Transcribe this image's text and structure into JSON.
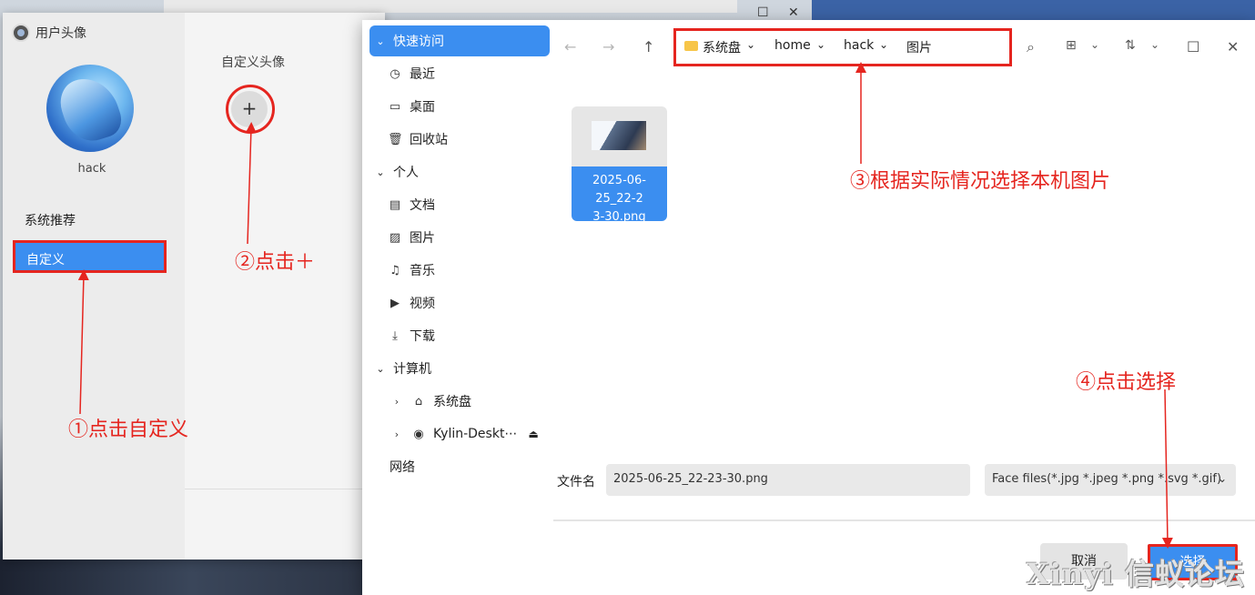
{
  "avatar_window": {
    "title": "用户头像",
    "user_name": "hack",
    "nav": {
      "system_recommend": "系统推荐",
      "custom": "自定义"
    },
    "custom_avatar_label": "自定义头像",
    "add_symbol": "+"
  },
  "file_dialog": {
    "sidebar": {
      "quick_access": "快速访问",
      "recent": "最近",
      "desktop": "桌面",
      "trash": "回收站",
      "personal": "个人",
      "documents": "文档",
      "pictures": "图片",
      "music": "音乐",
      "videos": "视频",
      "downloads": "下载",
      "computer": "计算机",
      "system_disk": "系统盘",
      "kylin_desktop": "Kylin-Deskt⋯",
      "network": "网络"
    },
    "breadcrumb": [
      "系统盘",
      "home",
      "hack",
      "图片"
    ],
    "files": [
      {
        "name": "2025-06-25_22-23-30.png"
      }
    ],
    "file_tile_text": {
      "line1": "2025-06-25_22-2",
      "line2": "3-30.png"
    },
    "filename_label": "文件名",
    "filename_value": "2025-06-25_22-23-30.png",
    "filter_value": "Face files(*.jpg *.jpeg *.png *.svg *.gif)",
    "cancel_label": "取消",
    "select_label": "选择"
  },
  "annotations": {
    "step1": "①点击自定义",
    "step2": "②点击＋",
    "step3": "③根据实际情况选择本机图片",
    "step4": "④点击选择",
    "color": "#e5251f"
  },
  "watermark": "Xinyi 信蚁论坛",
  "colors": {
    "accent": "#3b8ef0",
    "annotation_red": "#e5251f"
  }
}
